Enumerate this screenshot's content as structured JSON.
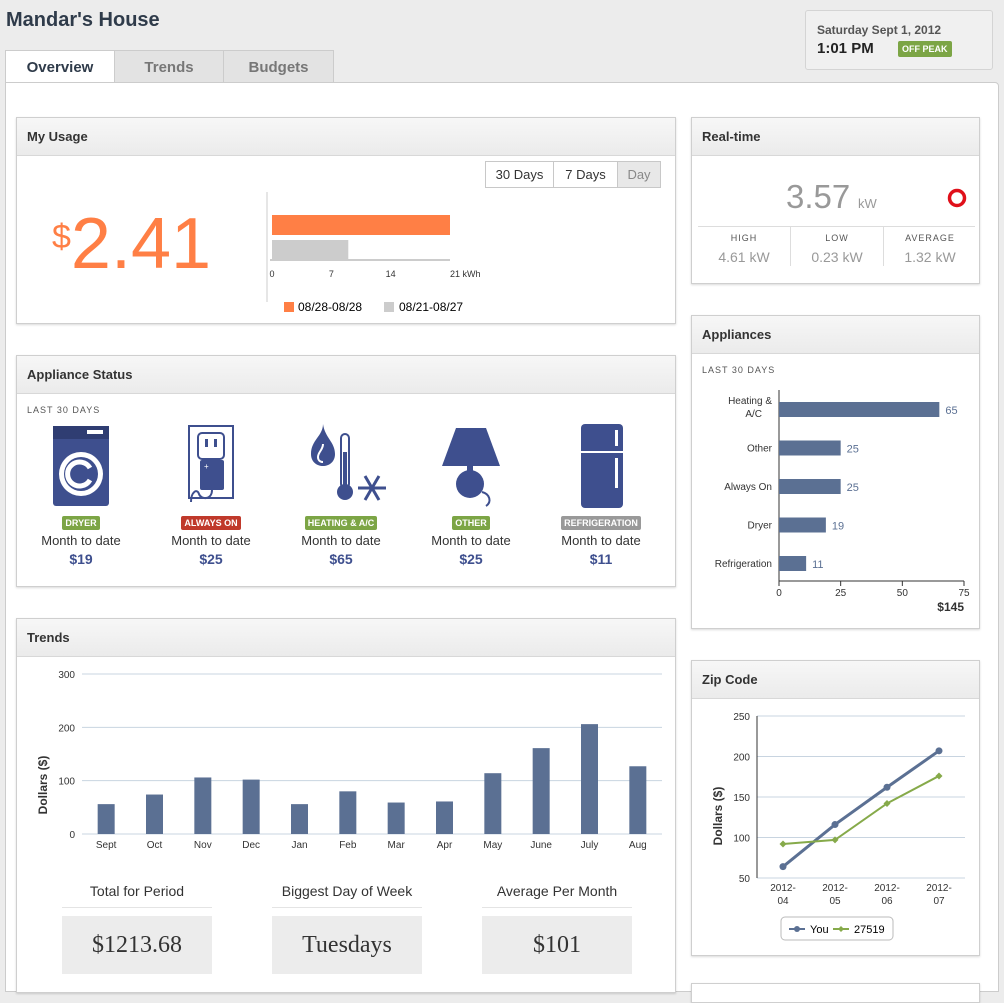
{
  "header": {
    "title": "Mandar's House",
    "date": "Saturday Sept 1, 2012",
    "time": "1:01 PM",
    "peak": "OFF PEAK"
  },
  "tabs": [
    "Overview",
    "Trends",
    "Budgets"
  ],
  "usage": {
    "title": "My Usage",
    "cur": "$",
    "amount": "2.41",
    "ranges": [
      "30 Days",
      "7 Days",
      "Day"
    ],
    "ticks": [
      "0",
      "7",
      "14",
      "21 kWh"
    ],
    "bars": [
      {
        "label": "08/28-08/28",
        "value": 21,
        "color": "#ff7f45"
      },
      {
        "label": "08/21-08/27",
        "value": 9,
        "color": "#cccccc"
      }
    ]
  },
  "realtime": {
    "title": "Real-time",
    "value": "3.57",
    "unit": "kW",
    "stats": [
      {
        "label": "HIGH",
        "value": "4.61 kW"
      },
      {
        "label": "LOW",
        "value": "0.23 kW"
      },
      {
        "label": "AVERAGE",
        "value": "1.32 kW"
      }
    ]
  },
  "status": {
    "title": "Appliance Status",
    "period": "LAST 30 DAYS",
    "items": [
      {
        "badge": "DRYER",
        "color": "#7ca545",
        "mtd": "Month to date",
        "amount": "$19",
        "icon": "washer-icon"
      },
      {
        "badge": "ALWAYS ON",
        "color": "#c0392b",
        "mtd": "Month to date",
        "amount": "$25",
        "icon": "outlet-icon"
      },
      {
        "badge": "HEATING & A/C",
        "color": "#7ca545",
        "mtd": "Month to date",
        "amount": "$65",
        "icon": "heating-cooling-icon"
      },
      {
        "badge": "OTHER",
        "color": "#7ca545",
        "mtd": "Month to date",
        "amount": "$25",
        "icon": "lamp-icon"
      },
      {
        "badge": "REFRIGERATION",
        "color": "#999999",
        "mtd": "Month to date",
        "amount": "$11",
        "icon": "fridge-icon"
      }
    ]
  },
  "appliances": {
    "title": "Appliances",
    "period": "LAST 30 DAYS",
    "total": "$145"
  },
  "trends": {
    "title": "Trends",
    "totals": [
      {
        "label": "Total for Period",
        "value": "$1213.68"
      },
      {
        "label": "Biggest Day of Week",
        "value": "Tuesdays"
      },
      {
        "label": "Average Per Month",
        "value": "$101"
      }
    ]
  },
  "zipcode": {
    "title": "Zip Code"
  },
  "chart_data": [
    {
      "type": "bar",
      "title": "My Usage",
      "categories": [
        "08/28-08/28",
        "08/21-08/27"
      ],
      "values": [
        21,
        9
      ],
      "xlim": [
        0,
        21
      ],
      "xlabel": "kWh"
    },
    {
      "type": "bar",
      "title": "Appliances",
      "categories": [
        "Heating & A/C",
        "Other",
        "Always On",
        "Dryer",
        "Refrigeration"
      ],
      "values": [
        65,
        25,
        25,
        19,
        11
      ],
      "xlim": [
        0,
        75
      ],
      "xticks": [
        0,
        25,
        50,
        75
      ],
      "color": "#5b7093"
    },
    {
      "type": "bar",
      "title": "Trends",
      "ylabel": "Dollars ($)",
      "categories": [
        "Sept",
        "Oct",
        "Nov",
        "Dec",
        "Jan",
        "Feb",
        "Mar",
        "Apr",
        "May",
        "June",
        "July",
        "Aug"
      ],
      "values": [
        56,
        74,
        106,
        102,
        56,
        80,
        59,
        61,
        114,
        161,
        206,
        127
      ],
      "ylim": [
        0,
        300
      ],
      "yticks": [
        0,
        100,
        200,
        300
      ],
      "grid": true,
      "color": "#5b7093"
    },
    {
      "type": "line",
      "title": "Zip Code",
      "ylabel": "Dollars ($)",
      "categories": [
        "2012-04",
        "2012-05",
        "2012-06",
        "2012-07"
      ],
      "ylim": [
        50,
        250
      ],
      "yticks": [
        50,
        100,
        150,
        200,
        250
      ],
      "legend": "bottom",
      "series": [
        {
          "name": "You",
          "values": [
            64,
            116,
            162,
            207
          ],
          "color": "#5b7093"
        },
        {
          "name": "27519",
          "values": [
            92,
            97,
            142,
            176
          ],
          "color": "#86aa4a"
        }
      ]
    }
  ]
}
